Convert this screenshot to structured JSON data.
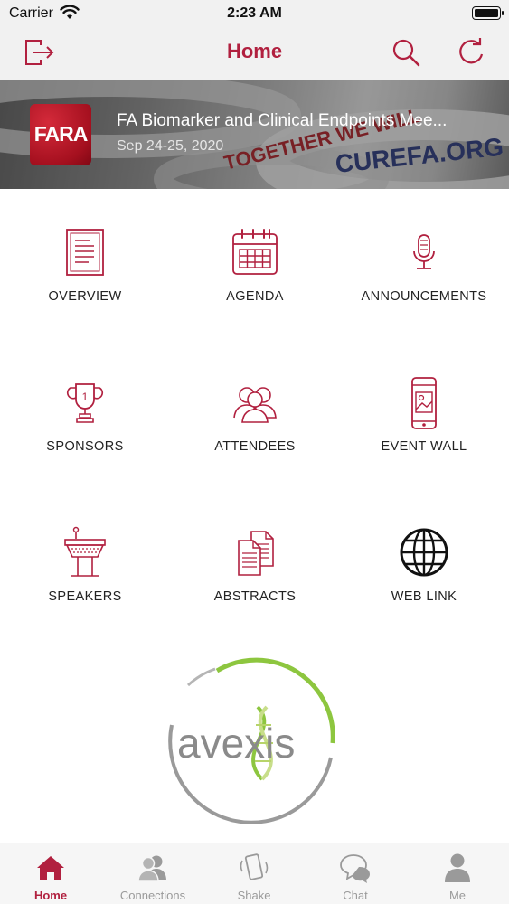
{
  "status": {
    "carrier": "Carrier",
    "time": "2:23 AM"
  },
  "nav": {
    "title": "Home",
    "logout_icon": "logout-icon",
    "search_icon": "search-icon",
    "refresh_icon": "refresh-icon"
  },
  "event": {
    "logo_text": "FARA",
    "title": "FA Biomarker and Clinical Endpoints Mee...",
    "date": "Sep 24-25, 2020"
  },
  "banner_text": [
    "CUREFA.ORG",
    "TOGETHER WE WILL"
  ],
  "grid": [
    {
      "label": "OVERVIEW",
      "icon": "document-icon"
    },
    {
      "label": "AGENDA",
      "icon": "calendar-icon"
    },
    {
      "label": "ANNOUNCEMENTS",
      "icon": "microphone-icon"
    },
    {
      "label": "SPONSORS",
      "icon": "trophy-icon"
    },
    {
      "label": "ATTENDEES",
      "icon": "people-icon"
    },
    {
      "label": "EVENT WALL",
      "icon": "phone-image-icon"
    },
    {
      "label": "SPEAKERS",
      "icon": "podium-icon"
    },
    {
      "label": "ABSTRACTS",
      "icon": "documents-icon"
    },
    {
      "label": "WEB LINK",
      "icon": "globe-icon"
    }
  ],
  "sponsor": {
    "name": "avexis"
  },
  "tabs": [
    {
      "label": "Home",
      "icon": "home-icon",
      "active": true
    },
    {
      "label": "Connections",
      "icon": "connections-icon",
      "active": false
    },
    {
      "label": "Shake",
      "icon": "shake-phone-icon",
      "active": false
    },
    {
      "label": "Chat",
      "icon": "chat-icon",
      "active": false
    },
    {
      "label": "Me",
      "icon": "person-icon",
      "active": false
    }
  ],
  "colors": {
    "accent": "#b1203f",
    "inactive": "#9a9a9a",
    "bar": "#f1f1f1"
  }
}
